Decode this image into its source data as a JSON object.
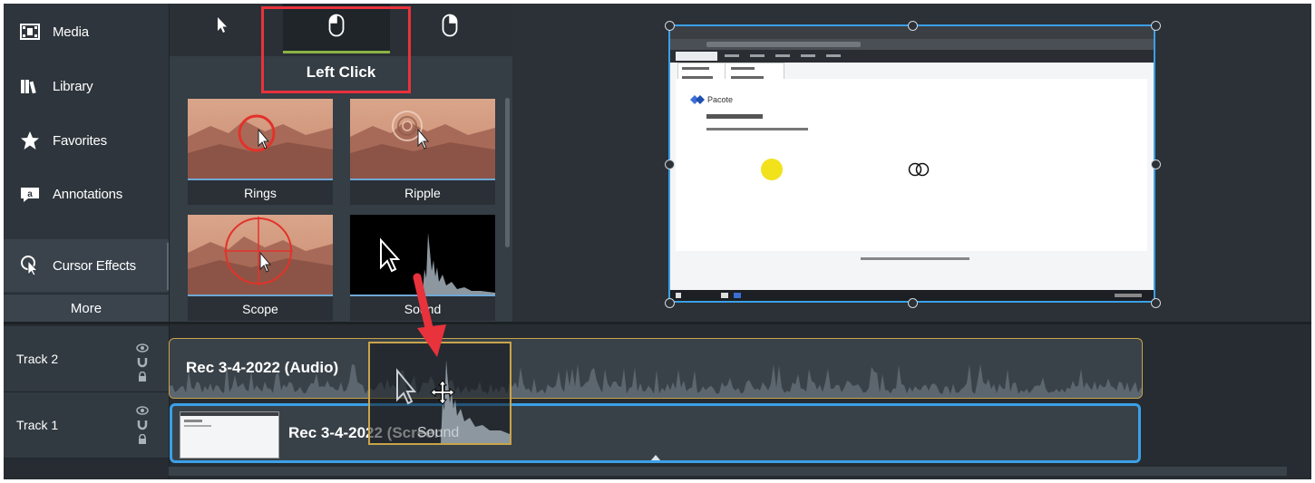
{
  "sidebar": {
    "items": [
      {
        "label": "Media",
        "icon": "film-icon"
      },
      {
        "label": "Library",
        "icon": "library-icon"
      },
      {
        "label": "Favorites",
        "icon": "star-icon"
      },
      {
        "label": "Annotations",
        "icon": "annotation-icon"
      },
      {
        "label": "Cursor Effects",
        "icon": "cursor-effects-icon",
        "active": true
      }
    ],
    "more_label": "More"
  },
  "cursor_panel": {
    "tabs": [
      {
        "icon": "pointer-icon"
      },
      {
        "icon": "left-mouse-icon",
        "selected": true
      },
      {
        "icon": "right-mouse-icon"
      }
    ],
    "selected_tab_label": "Left Click",
    "effects": [
      {
        "label": "Rings"
      },
      {
        "label": "Ripple"
      },
      {
        "label": "Scope"
      },
      {
        "label": "Sound"
      }
    ]
  },
  "preview": {
    "screen_app_label": "Pacote"
  },
  "timeline": {
    "tracks": [
      {
        "name": "Track 2",
        "clip_title": "Rec 3-4-2022 (Audio)"
      },
      {
        "name": "Track 1",
        "clip_title": "Rec 3-4-2022 (Screen)"
      }
    ],
    "drag_label": "Sound"
  },
  "colors": {
    "selection_blue": "#3aa0e8",
    "highlight_red": "#e8323c",
    "audio_border": "#c8a44a",
    "tab_accent": "#8bb344"
  }
}
